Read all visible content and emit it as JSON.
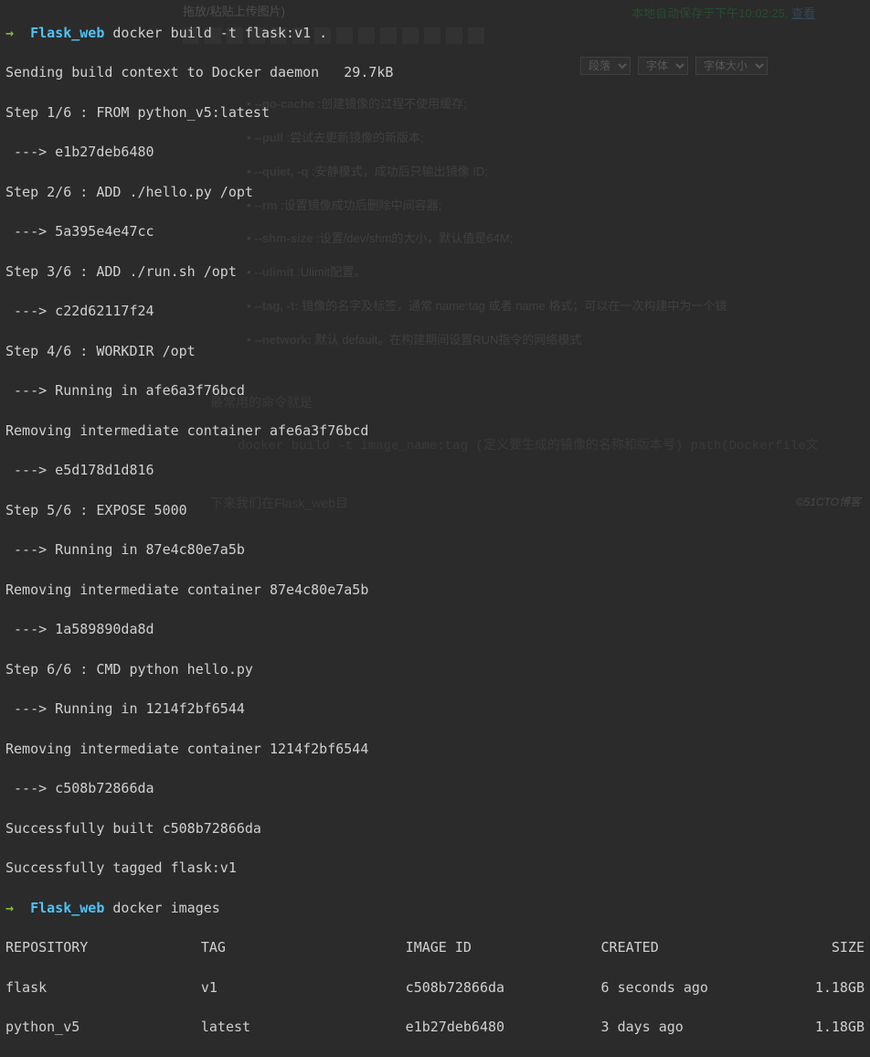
{
  "editor": {
    "drag_hint": "拖放/粘贴上传图片)",
    "autosave": "本地自动保存于下午10:02:25,",
    "view_link": "查看",
    "para_select": "段落",
    "font_select": "字体",
    "fontsize_select": "字体大小",
    "bg_items": [
      {
        "flag": "--no-cache",
        "desc": " :创建镜像的过程不使用缓存;"
      },
      {
        "flag": "--pull",
        "desc": " :尝试去更新镜像的新版本;"
      },
      {
        "flag": "--quiet, -q",
        "desc": " :安静模式，成功后只输出镜像 ID;"
      },
      {
        "flag": "--rm",
        "desc": " :设置镜像成功后删除中间容器;"
      },
      {
        "flag": "--shm-size",
        "desc": " :设置/dev/shm的大小，默认值是64M;"
      },
      {
        "flag": "--ulimit",
        "desc": " :Ulimit配置。"
      },
      {
        "flag": "--tag, -t:",
        "desc": " 镜像的名字及标签，通常 name:tag 或者 name 格式；可以在一次构建中为一个镜"
      },
      {
        "flag": "--network:",
        "desc": " 默认 default。在构建期间设置RUN指令的网络模式"
      }
    ],
    "common_cmd": "最常用的命令就是",
    "docker_example": "docker  build -t  image_name:tag (定义要生成的镜像的名称和版本号)   path(Dockerfile文",
    "flask_hint": "下来我们在Flask_web目",
    "watermark": "©51CTO博客"
  },
  "terminal": {
    "prompt1_dir": "Flask_web",
    "prompt1_cmd": "docker build -t flask:v1 .",
    "lines": [
      "Sending build context to Docker daemon   29.7kB",
      "Step 1/6 : FROM python_v5:latest",
      " ---> e1b27deb6480",
      "Step 2/6 : ADD ./hello.py /opt",
      " ---> 5a395e4e47cc",
      "Step 3/6 : ADD ./run.sh /opt",
      " ---> c22d62117f24",
      "Step 4/6 : WORKDIR /opt",
      " ---> Running in afe6a3f76bcd",
      "Removing intermediate container afe6a3f76bcd",
      " ---> e5d178d1d816",
      "Step 5/6 : EXPOSE 5000",
      " ---> Running in 87e4c80e7a5b",
      "Removing intermediate container 87e4c80e7a5b",
      " ---> 1a589890da8d",
      "Step 6/6 : CMD python hello.py",
      " ---> Running in 1214f2bf6544",
      "Removing intermediate container 1214f2bf6544",
      " ---> c508b72866da",
      "Successfully built c508b72866da",
      "Successfully tagged flask:v1"
    ],
    "prompt2_dir": "Flask_web",
    "prompt2_cmd": "docker images",
    "table_header": {
      "repo": "REPOSITORY",
      "tag": "TAG",
      "image": "IMAGE ID",
      "created": "CREATED",
      "size": "SIZE"
    },
    "table_rows": [
      {
        "repo": "flask",
        "tag": "v1",
        "image": "c508b72866da",
        "created": "6 seconds ago",
        "size": "1.18GB"
      },
      {
        "repo": "python_v5",
        "tag": "latest",
        "image": "e1b27deb6480",
        "created": "3 days ago",
        "size": "1.18GB"
      }
    ]
  }
}
